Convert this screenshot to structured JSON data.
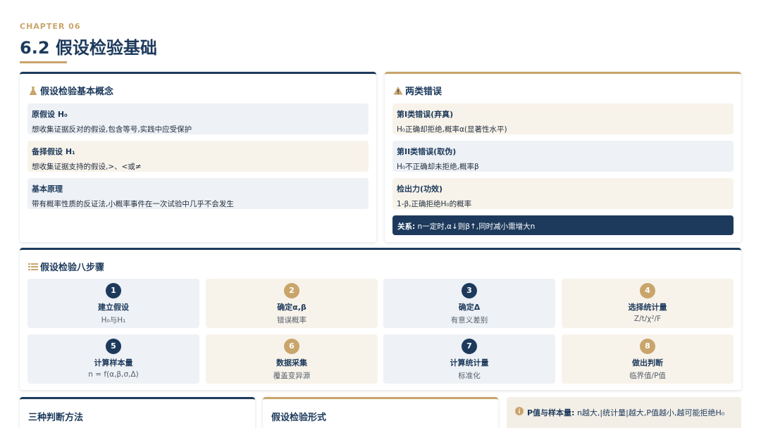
{
  "header": {
    "chapter": "CHAPTER 06",
    "title": "6.2 假设检验基础"
  },
  "concepts": {
    "title": "假设检验基本概念",
    "icon": "flask-icon",
    "items": [
      {
        "heading": "原假设 H₀",
        "desc": "想收集证据反对的假设,包含等号,实践中应受保护"
      },
      {
        "heading": "备择假设 H₁",
        "desc": "想收集证据支持的假设,>、<或≠"
      },
      {
        "heading": "基本原理",
        "desc": "带有概率性质的反证法,小概率事件在一次试验中几乎不会发生"
      }
    ]
  },
  "errors": {
    "title": "两类错误",
    "icon": "warning-icon",
    "items": [
      {
        "heading": "第I类错误(弃真)",
        "desc": "H₀正确却拒绝,概率α(显著性水平)"
      },
      {
        "heading": "第II类错误(取伪)",
        "desc": "H₀不正确却未拒绝,概率β"
      },
      {
        "heading": "检出力(功效)",
        "desc": "1-β,正确拒绝H₀的概率"
      }
    ],
    "relation_label": "关系:",
    "relation_text": " n一定时,α↓则β↑,同时减小需增大n"
  },
  "steps": {
    "title": "假设检验八步骤",
    "icon": "list-icon",
    "items": [
      {
        "num": "1",
        "title": "建立假设",
        "desc": "H₀与H₁"
      },
      {
        "num": "2",
        "title": "确定α,β",
        "desc": "错误概率"
      },
      {
        "num": "3",
        "title": "确定Δ",
        "desc": "有意义差别"
      },
      {
        "num": "4",
        "title": "选择统计量",
        "desc": "Z/t/χ²/F"
      },
      {
        "num": "5",
        "title": "计算样本量",
        "desc": "n = f(α,β,σ,Δ)"
      },
      {
        "num": "6",
        "title": "数据采集",
        "desc": "覆盖变异源"
      },
      {
        "num": "7",
        "title": "计算统计量",
        "desc": "标准化"
      },
      {
        "num": "8",
        "title": "做出判断",
        "desc": "临界值/P值"
      }
    ]
  },
  "methods": {
    "title": "三种判断方法"
  },
  "forms": {
    "title": "假设检验形式"
  },
  "note": {
    "icon": "info-icon",
    "label": "P值与样本量:",
    "text": " n越大,|统计量|越大,P值越小,越可能拒绝H₀"
  },
  "colors": {
    "navy": "#1d3a5c",
    "gold": "#c9a56b",
    "grey": "#eef1f5",
    "cream": "#f8f3ea"
  }
}
